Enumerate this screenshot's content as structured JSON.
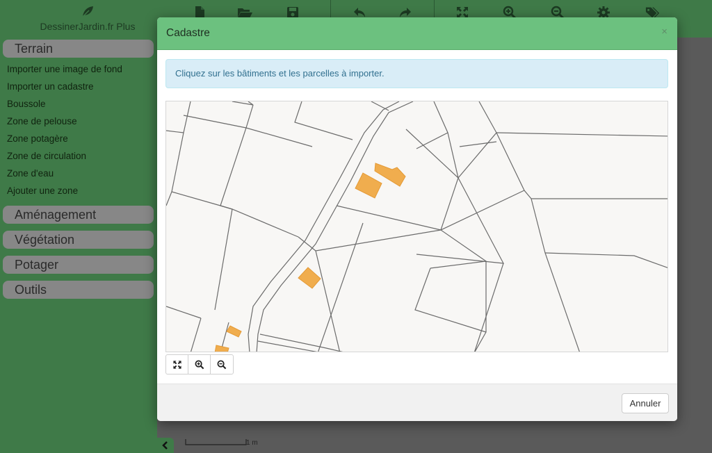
{
  "app": {
    "brand_title": "DessinerJardin.fr Plus",
    "brand_icon": "leaf-icon",
    "scale_label": "1 m"
  },
  "toolbar": {
    "icons": [
      "file-icon",
      "folder-open-icon",
      "save-icon",
      "undo-icon",
      "redo-icon",
      "fullscreen-icon",
      "zoom-in-icon",
      "zoom-out-icon",
      "gear-icon",
      "tags-icon"
    ]
  },
  "sidebar": {
    "sections": {
      "terrain": "Terrain",
      "amenagement": "Aménagement",
      "vegetation": "Végétation",
      "potager": "Potager",
      "outils": "Outils"
    },
    "terrain_items": [
      "Importer une image de fond",
      "Importer un cadastre",
      "Boussole",
      "Zone de pelouse",
      "Zone potagère",
      "Zone de circulation",
      "Zone d'eau",
      "Ajouter une zone"
    ]
  },
  "modal": {
    "title": "Cadastre",
    "close_symbol": "×",
    "info_text": "Cliquez sur les bâtiments et les parcelles à importer.",
    "cancel_label": "Annuler",
    "map_controls": [
      "fullscreen-icon",
      "zoom-in-icon",
      "zoom-out-icon"
    ]
  },
  "colors": {
    "sidebar_bg": "#3f7a48",
    "modal_header_bg": "#6cc17f",
    "alert_bg": "#d9edf7",
    "alert_text": "#31708f",
    "building": "#f0ad4e",
    "parcel_line": "#666666"
  }
}
